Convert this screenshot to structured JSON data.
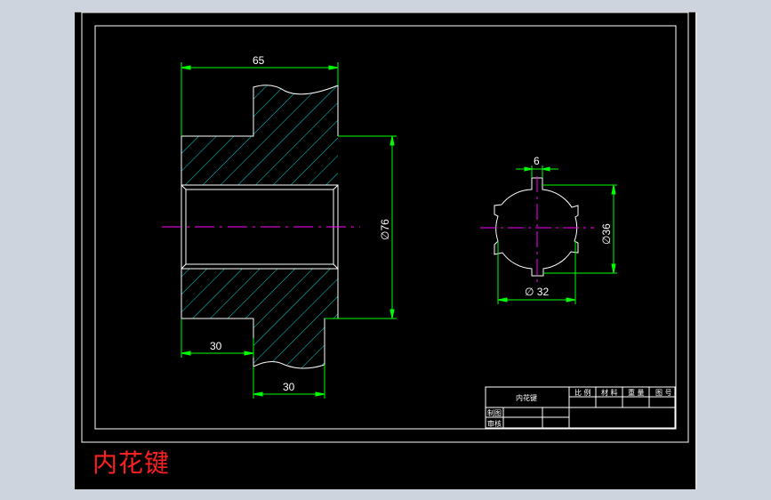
{
  "drawing": {
    "section_view": {
      "dim_total_length": "65",
      "dim_outer_diameter": "∅76",
      "dim_bore_length": "30",
      "dim_hub_length": "30"
    },
    "end_view": {
      "dim_key_width": "6",
      "dim_major_diameter": "∅36",
      "dim_minor_diameter": "∅ 32"
    },
    "title_block": {
      "part_name": "内花键",
      "col_scale": "比 例",
      "col_material": "材 料",
      "col_weight": "重 量",
      "col_drawing_no": "图 号",
      "row_drawn": "制图",
      "row_checked": "审核"
    }
  },
  "caption": "内花键",
  "colors": {
    "background": "#cdd4de",
    "sheet": "#000000",
    "outline": "#ffffff",
    "dimension": "#00ff00",
    "hatch": "#00d8d8",
    "centerline": "#ff00ff",
    "caption": "#ff2020"
  }
}
